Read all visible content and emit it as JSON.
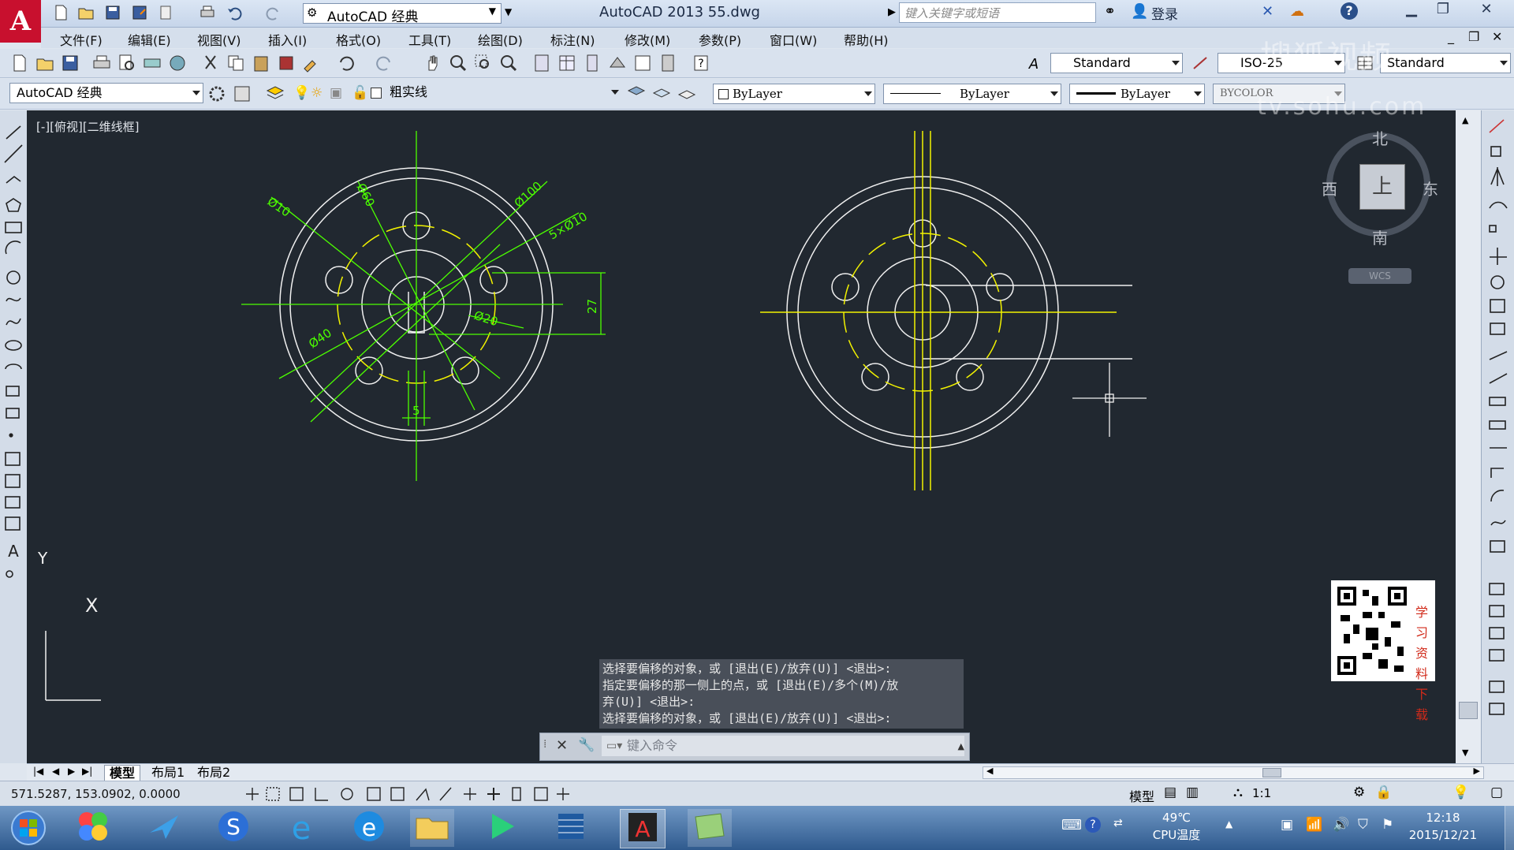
{
  "titlebar": {
    "workspace": "AutoCAD 经典",
    "title": "AutoCAD 2013     55.dwg",
    "search_placeholder": "键入关键字或短语",
    "login": "登录",
    "help": "?"
  },
  "menus": [
    "文件(F)",
    "编辑(E)",
    "视图(V)",
    "插入(I)",
    "格式(O)",
    "工具(T)",
    "绘图(D)",
    "标注(N)",
    "修改(M)",
    "参数(P)",
    "窗口(W)",
    "帮助(H)"
  ],
  "styles": {
    "text_style": "Standard",
    "dim_style": "ISO-25",
    "table_style": "Standard"
  },
  "layers": {
    "workspace_combo": "AutoCAD 经典",
    "current_layer": "粗实线",
    "color": "ByLayer",
    "linetype": "ByLayer",
    "lineweight": "ByLayer",
    "plotstyle": "BYCOLOR"
  },
  "viewport_label": "[-][俯视][二维线框]",
  "navcube": {
    "north": "北",
    "south": "南",
    "east": "东",
    "west": "西",
    "top": "上",
    "wcs": "WCS"
  },
  "ucs": {
    "x": "X",
    "y": "Y"
  },
  "drawing": {
    "dims": [
      "Ø10",
      "Ø60",
      "Ø100",
      "5×Ø10",
      "Ø20",
      "Ø40",
      "27",
      "5"
    ]
  },
  "command": {
    "history": [
      "选择要偏移的对象，或 [退出(E)/放弃(U)] <退出>:",
      "指定要偏移的那一侧上的点，或 [退出(E)/多个(M)/放",
      "弃(U)] <退出>:",
      "选择要偏移的对象，或 [退出(E)/放弃(U)] <退出>:"
    ],
    "placeholder": "键入命令"
  },
  "qr": {
    "text": "学习资料下载"
  },
  "tabs": [
    "模型",
    "布局1",
    "布局2"
  ],
  "status": {
    "coords": "571.5287, 153.0902, 0.0000",
    "model": "模型",
    "scale": "1:1"
  },
  "taskbar": {
    "temp": "49℃",
    "temp_label": "CPU温度",
    "time": "12:18",
    "date": "2015/12/21"
  },
  "watermark": {
    "line1": "搜狐视频",
    "line2": "tv.sohu.com"
  },
  "colors": {
    "canvas": "#212830",
    "green": "#4cff00",
    "yellow": "#f2f200",
    "white": "#f0f0f0",
    "red": "#c8102e"
  }
}
